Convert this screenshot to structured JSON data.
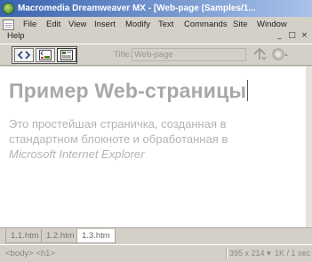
{
  "window": {
    "title": "Macromedia Dreamweaver MX - [Web-page (Samples/1...",
    "controls": [
      "_",
      "□",
      "×"
    ]
  },
  "menu": {
    "items": [
      "File",
      "Edit",
      "View",
      "Insert",
      "Modify",
      "Text",
      "Commands",
      "Site",
      "Window"
    ],
    "help": "Help"
  },
  "toolbar": {
    "views": [
      {
        "name": "code-view",
        "active": false
      },
      {
        "name": "split-view",
        "active": false
      },
      {
        "name": "design-view",
        "active": true
      }
    ],
    "title_label": "Title:",
    "title_value": "Web-page",
    "icons": [
      "file-management-icon",
      "preview-icon"
    ]
  },
  "document": {
    "heading": "Пример Web-страницы",
    "paragraph_plain": "Это простейшая страничка, созданная в стандартном блокноте и обработанная в ",
    "paragraph_italic": "Microsoft Internet Explorer"
  },
  "tabs": [
    {
      "label": "1.1.htm",
      "active": false
    },
    {
      "label": "1.2.htm",
      "active": false
    },
    {
      "label": "1.3.htm",
      "active": true
    }
  ],
  "status": {
    "tag_selector": "<body> <h1>",
    "window_size": "395 x 214",
    "download_stats": "1K / 1 sec"
  },
  "colors": {
    "titlebar_start": "#3a64b0",
    "titlebar_end": "#a9c2e9",
    "chrome": "#d4d0c8"
  }
}
